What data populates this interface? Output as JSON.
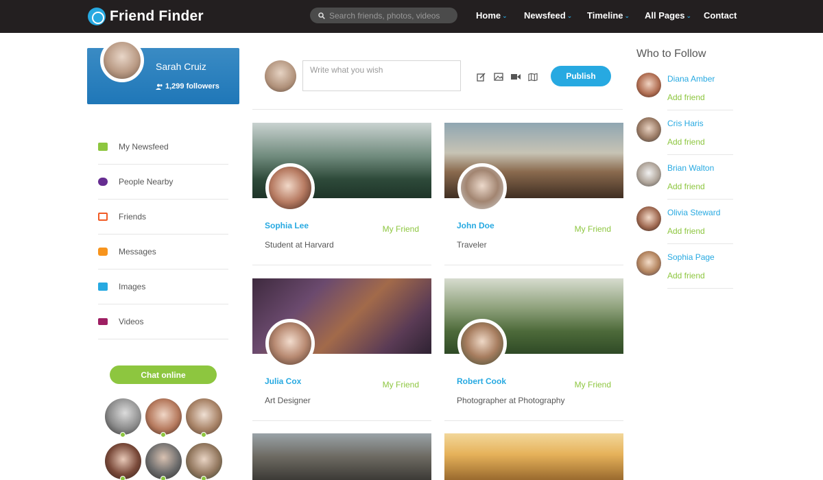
{
  "header": {
    "brand": "Friend Finder",
    "search_placeholder": "Search friends, photos, videos",
    "nav": [
      {
        "label": "Home",
        "has_dropdown": true
      },
      {
        "label": "Newsfeed",
        "has_dropdown": true
      },
      {
        "label": "Timeline",
        "has_dropdown": true
      },
      {
        "label": "All Pages",
        "has_dropdown": true
      },
      {
        "label": "Contact",
        "has_dropdown": false
      }
    ]
  },
  "profile": {
    "name": "Sarah Cruiz",
    "followers": "1,299 followers"
  },
  "sidebar": {
    "items": [
      {
        "label": "My Newsfeed",
        "icon": "newsfeed-icon",
        "color": "#8dc63f"
      },
      {
        "label": "People Nearby",
        "icon": "people-icon",
        "color": "#662d91"
      },
      {
        "label": "Friends",
        "icon": "friends-icon",
        "color": "#f15a24"
      },
      {
        "label": "Messages",
        "icon": "messages-icon",
        "color": "#f7941d"
      },
      {
        "label": "Images",
        "icon": "images-icon",
        "color": "#27a9e1"
      },
      {
        "label": "Videos",
        "icon": "videos-icon",
        "color": "#9e1f63"
      }
    ],
    "chat_button": "Chat online",
    "online_count_visible": 6
  },
  "composer": {
    "placeholder": "Write what you wish",
    "tools": [
      "edit-icon",
      "image-icon",
      "video-icon",
      "map-icon"
    ],
    "publish_label": "Publish"
  },
  "friends": [
    {
      "name": "Sophia Lee",
      "relation": "My Friend",
      "role": "Student at Harvard",
      "cover": "forest"
    },
    {
      "name": "John Doe",
      "relation": "My Friend",
      "role": "Traveler",
      "cover": "volcano"
    },
    {
      "name": "Julia Cox",
      "relation": "My Friend",
      "role": "Art Designer",
      "cover": "flowers"
    },
    {
      "name": "Robert Cook",
      "relation": "My Friend",
      "role": "Photographer at Photography",
      "cover": "woods"
    }
  ],
  "who_to_follow": {
    "title": "Who to Follow",
    "people": [
      {
        "name": "Diana Amber",
        "action": "Add friend"
      },
      {
        "name": "Cris Haris",
        "action": "Add friend"
      },
      {
        "name": "Brian Walton",
        "action": "Add friend"
      },
      {
        "name": "Olivia Steward",
        "action": "Add friend"
      },
      {
        "name": "Sophia Page",
        "action": "Add friend"
      }
    ]
  },
  "colors": {
    "header_bg": "#231f20",
    "accent_blue": "#27a9e1",
    "accent_green": "#8dc63f"
  }
}
